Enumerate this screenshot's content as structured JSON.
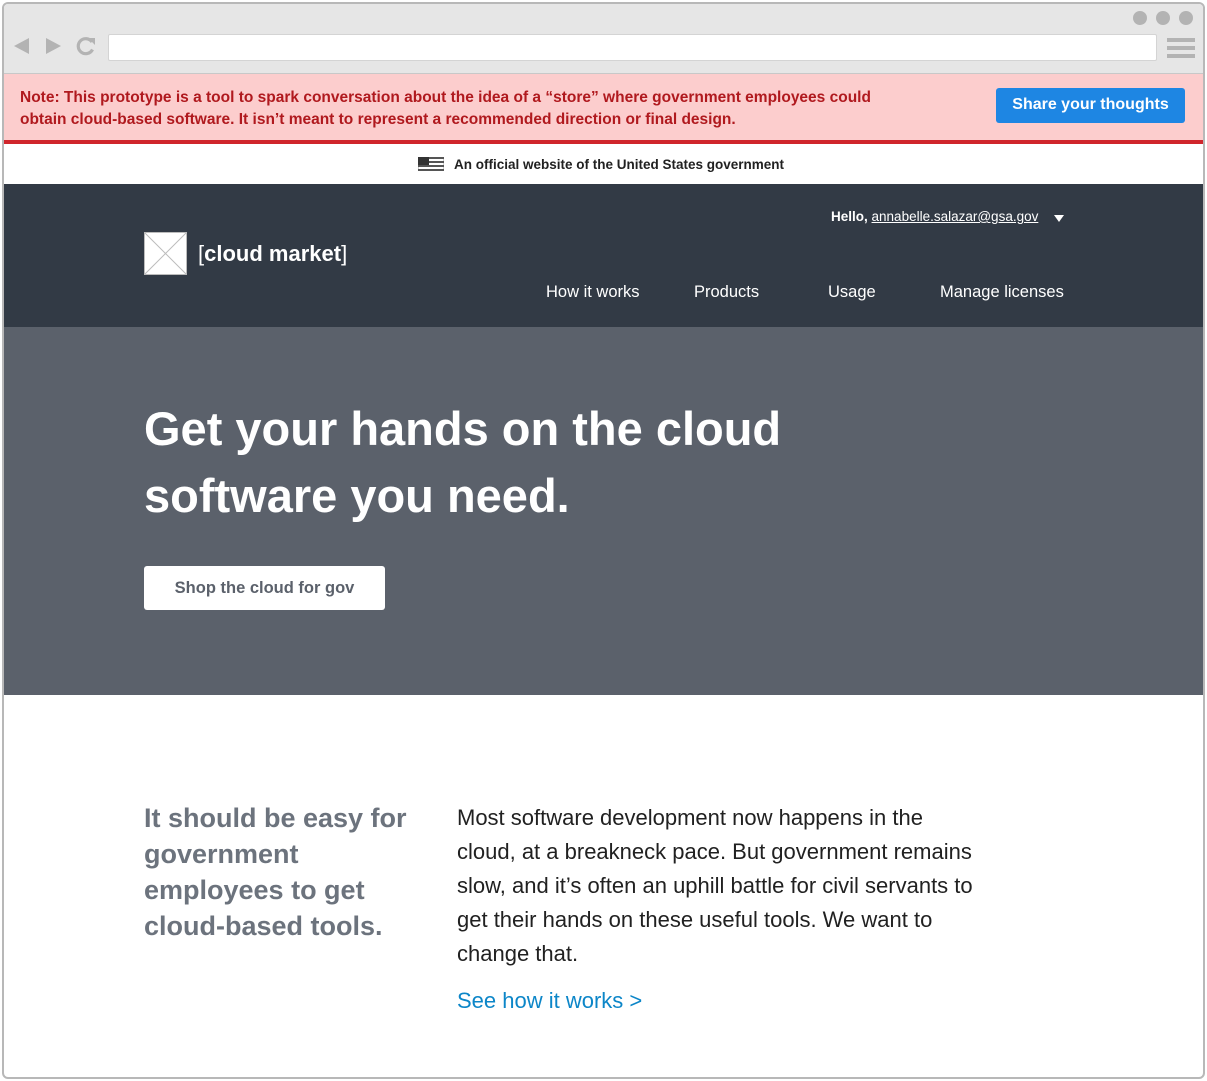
{
  "browser": {
    "back_icon": "arrow-left-icon",
    "forward_icon": "arrow-right-icon",
    "reload_icon": "reload-icon",
    "menu_icon": "hamburger-menu-icon",
    "url": ""
  },
  "prototype_banner": {
    "note": "Note: This prototype is a tool to spark conversation about the idea of a “store” where government employees could obtain cloud-based software. It isn’t meant to represent a recommended direction or final design.",
    "button_label": "Share your thoughts"
  },
  "gov_banner": {
    "text": "An official website of the United States government",
    "flag_icon": "us-flag-icon"
  },
  "header": {
    "logo_bracket_open": "[",
    "logo_name": "cloud market",
    "logo_bracket_close": "]",
    "greeting": "Hello,",
    "user_email": "annabelle.salazar@gsa.gov",
    "nav": [
      "How it works",
      "Products",
      "Usage",
      "Manage licenses"
    ]
  },
  "hero": {
    "title_line1": "Get your hands on the cloud",
    "title_line2": "software you need.",
    "button_label": "Shop the cloud for gov"
  },
  "intro": {
    "heading": "It should be easy for government employees to get cloud-based tools.",
    "body": "Most software development now happens in the cloud, at a breakneck pace. But government remains slow, and it’s often an uphill battle for civil servants to get their hands on these useful tools. We want to change that.",
    "link": "See how it works >"
  },
  "colors": {
    "banner_bg": "#fccdcd",
    "banner_text": "#b0191e",
    "accent_blue": "#1e86e3",
    "header_bg": "#323a45",
    "hero_bg": "#5b616b",
    "link_blue": "#0c86c8"
  }
}
